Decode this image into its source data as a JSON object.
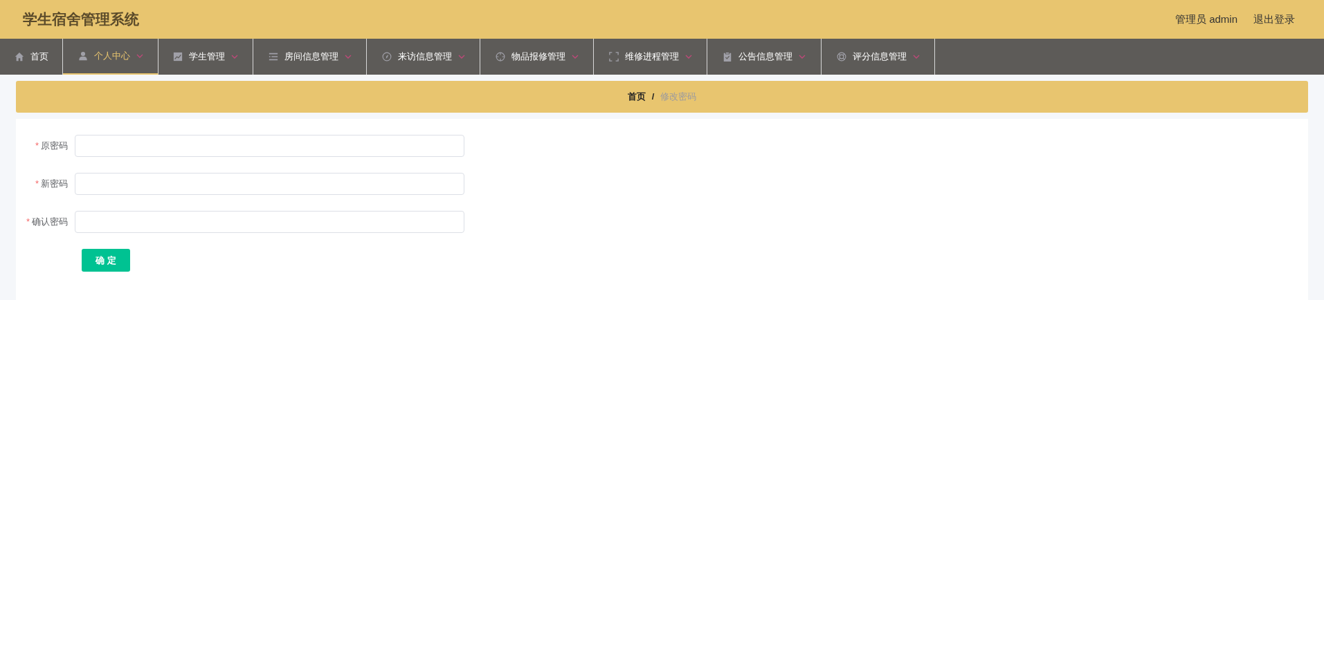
{
  "header": {
    "title": "学生宿舍管理系统",
    "user": "管理员 admin",
    "logout": "退出登录"
  },
  "nav": [
    {
      "label": "首页",
      "kind": "link",
      "selected": false
    },
    {
      "label": "个人中心",
      "kind": "menu",
      "selected": true
    },
    {
      "label": "学生管理",
      "kind": "menu",
      "selected": false
    },
    {
      "label": "房间信息管理",
      "kind": "menu",
      "selected": false
    },
    {
      "label": "来访信息管理",
      "kind": "menu",
      "selected": false
    },
    {
      "label": "物品报修管理",
      "kind": "menu",
      "selected": false
    },
    {
      "label": "维修进程管理",
      "kind": "menu",
      "selected": false
    },
    {
      "label": "公告信息管理",
      "kind": "menu",
      "selected": false
    },
    {
      "label": "评分信息管理",
      "kind": "menu",
      "selected": false
    }
  ],
  "breadcrumb": {
    "home": "首页",
    "separator": "/",
    "current": "修改密码"
  },
  "form": {
    "fields": [
      {
        "label": "原密码",
        "required_mark": "*"
      },
      {
        "label": "新密码",
        "required_mark": "*"
      },
      {
        "label": "确认密码",
        "required_mark": "*"
      }
    ],
    "submit": "确 定"
  }
}
